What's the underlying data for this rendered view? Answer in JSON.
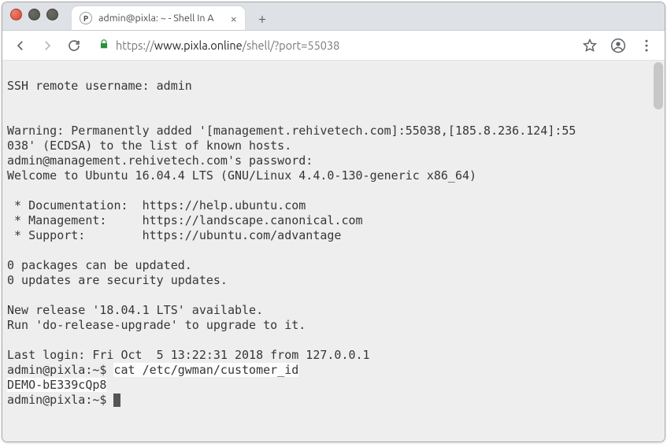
{
  "window": {
    "close": "close",
    "minimize": "minimize",
    "maximize": "maximize"
  },
  "tab": {
    "favicon_letter": "P",
    "title": "admin@pixla: ~ - Shell In A",
    "close": "×"
  },
  "newtab": "+",
  "address": {
    "scheme": "https://",
    "host": "www.pixla.online",
    "path": "/shell/?port=55038"
  },
  "terminal": {
    "l1": "SSH remote username: admin",
    "l2": "",
    "l3": "",
    "l4": "Warning: Permanently added '[management.rehivetech.com]:55038,[185.8.236.124]:55",
    "l5": "038' (ECDSA) to the list of known hosts.",
    "l6": "admin@management.rehivetech.com's password:",
    "l7": "Welcome to Ubuntu 16.04.4 LTS (GNU/Linux 4.4.0-130-generic x86_64)",
    "l8": "",
    "l9": " * Documentation:  https://help.ubuntu.com",
    "l10": " * Management:     https://landscape.canonical.com",
    "l11": " * Support:        https://ubuntu.com/advantage",
    "l12": "",
    "l13": "0 packages can be updated.",
    "l14": "0 updates are security updates.",
    "l15": "",
    "l16": "New release '18.04.1 LTS' available.",
    "l17": "Run 'do-release-upgrade' to upgrade to it.",
    "l18": "",
    "l19": "Last login: Fri Oct  5 13:22:31 2018 from 127.0.0.1",
    "p1_prompt": "admin@pixla:~$ ",
    "p1_cmd": "cat /etc/gwman/customer_id",
    "output": "DEMO-bE339cQp8",
    "p2_prompt": "admin@pixla:~$ "
  }
}
